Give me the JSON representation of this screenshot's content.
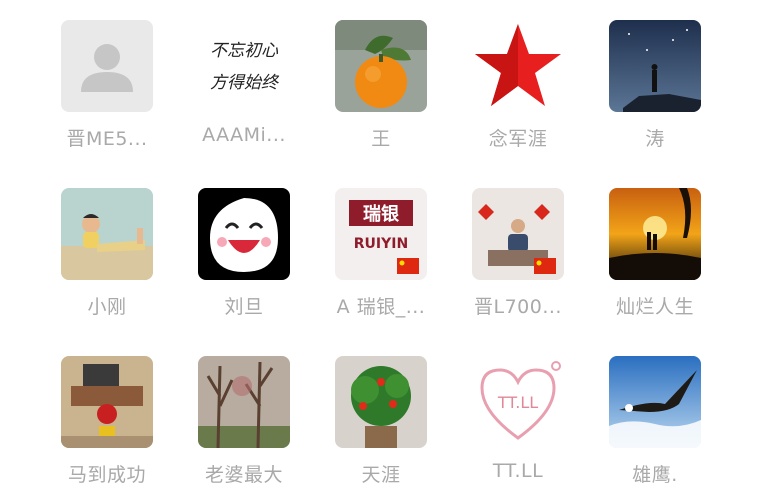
{
  "members": [
    {
      "name": "晋ME5...",
      "avatar": "default-user-icon"
    },
    {
      "name": "AAAMi...",
      "avatar": "calligraphy-avatar",
      "calligraphy_line1": "不忘初心",
      "calligraphy_line2": "方得始终"
    },
    {
      "name": "王",
      "avatar": "orange-fruit-avatar"
    },
    {
      "name": "念军涯",
      "avatar": "red-star-avatar"
    },
    {
      "name": "涛",
      "avatar": "starry-night-avatar"
    },
    {
      "name": "小刚",
      "avatar": "boy-lying-avatar"
    },
    {
      "name": "刘旦",
      "avatar": "laughing-face-avatar"
    },
    {
      "name": "A 瑞银_...",
      "avatar": "ruiyin-logo-avatar",
      "logo_cn": "瑞银",
      "logo_en": "RUIYIN"
    },
    {
      "name": "晋L700...",
      "avatar": "man-at-desk-avatar"
    },
    {
      "name": "灿烂人生",
      "avatar": "sunset-couple-avatar"
    },
    {
      "name": "马到成功",
      "avatar": "room-decor-avatar"
    },
    {
      "name": "老婆最大",
      "avatar": "bare-trees-avatar"
    },
    {
      "name": "天涯",
      "avatar": "potted-plant-avatar"
    },
    {
      "name": "TT.LL",
      "avatar": "heart-text-avatar",
      "heart_text": "TT.LL"
    },
    {
      "name": "雄鹰.",
      "avatar": "eagle-sky-avatar"
    }
  ]
}
